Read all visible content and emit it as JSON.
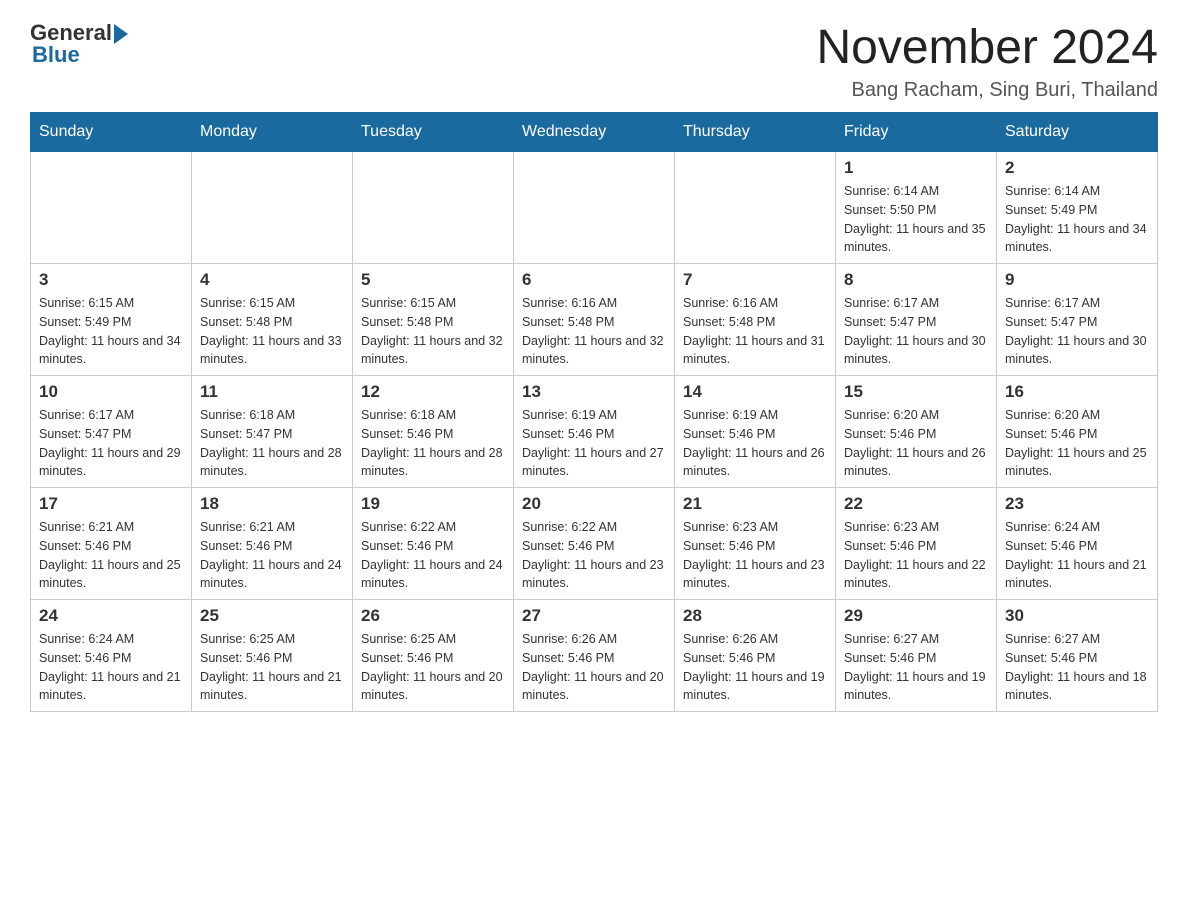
{
  "header": {
    "logo_general": "General",
    "logo_blue": "Blue",
    "month_title": "November 2024",
    "location": "Bang Racham, Sing Buri, Thailand"
  },
  "weekdays": [
    "Sunday",
    "Monday",
    "Tuesday",
    "Wednesday",
    "Thursday",
    "Friday",
    "Saturday"
  ],
  "weeks": [
    [
      {
        "day": "",
        "info": ""
      },
      {
        "day": "",
        "info": ""
      },
      {
        "day": "",
        "info": ""
      },
      {
        "day": "",
        "info": ""
      },
      {
        "day": "",
        "info": ""
      },
      {
        "day": "1",
        "info": "Sunrise: 6:14 AM\nSunset: 5:50 PM\nDaylight: 11 hours and 35 minutes."
      },
      {
        "day": "2",
        "info": "Sunrise: 6:14 AM\nSunset: 5:49 PM\nDaylight: 11 hours and 34 minutes."
      }
    ],
    [
      {
        "day": "3",
        "info": "Sunrise: 6:15 AM\nSunset: 5:49 PM\nDaylight: 11 hours and 34 minutes."
      },
      {
        "day": "4",
        "info": "Sunrise: 6:15 AM\nSunset: 5:48 PM\nDaylight: 11 hours and 33 minutes."
      },
      {
        "day": "5",
        "info": "Sunrise: 6:15 AM\nSunset: 5:48 PM\nDaylight: 11 hours and 32 minutes."
      },
      {
        "day": "6",
        "info": "Sunrise: 6:16 AM\nSunset: 5:48 PM\nDaylight: 11 hours and 32 minutes."
      },
      {
        "day": "7",
        "info": "Sunrise: 6:16 AM\nSunset: 5:48 PM\nDaylight: 11 hours and 31 minutes."
      },
      {
        "day": "8",
        "info": "Sunrise: 6:17 AM\nSunset: 5:47 PM\nDaylight: 11 hours and 30 minutes."
      },
      {
        "day": "9",
        "info": "Sunrise: 6:17 AM\nSunset: 5:47 PM\nDaylight: 11 hours and 30 minutes."
      }
    ],
    [
      {
        "day": "10",
        "info": "Sunrise: 6:17 AM\nSunset: 5:47 PM\nDaylight: 11 hours and 29 minutes."
      },
      {
        "day": "11",
        "info": "Sunrise: 6:18 AM\nSunset: 5:47 PM\nDaylight: 11 hours and 28 minutes."
      },
      {
        "day": "12",
        "info": "Sunrise: 6:18 AM\nSunset: 5:46 PM\nDaylight: 11 hours and 28 minutes."
      },
      {
        "day": "13",
        "info": "Sunrise: 6:19 AM\nSunset: 5:46 PM\nDaylight: 11 hours and 27 minutes."
      },
      {
        "day": "14",
        "info": "Sunrise: 6:19 AM\nSunset: 5:46 PM\nDaylight: 11 hours and 26 minutes."
      },
      {
        "day": "15",
        "info": "Sunrise: 6:20 AM\nSunset: 5:46 PM\nDaylight: 11 hours and 26 minutes."
      },
      {
        "day": "16",
        "info": "Sunrise: 6:20 AM\nSunset: 5:46 PM\nDaylight: 11 hours and 25 minutes."
      }
    ],
    [
      {
        "day": "17",
        "info": "Sunrise: 6:21 AM\nSunset: 5:46 PM\nDaylight: 11 hours and 25 minutes."
      },
      {
        "day": "18",
        "info": "Sunrise: 6:21 AM\nSunset: 5:46 PM\nDaylight: 11 hours and 24 minutes."
      },
      {
        "day": "19",
        "info": "Sunrise: 6:22 AM\nSunset: 5:46 PM\nDaylight: 11 hours and 24 minutes."
      },
      {
        "day": "20",
        "info": "Sunrise: 6:22 AM\nSunset: 5:46 PM\nDaylight: 11 hours and 23 minutes."
      },
      {
        "day": "21",
        "info": "Sunrise: 6:23 AM\nSunset: 5:46 PM\nDaylight: 11 hours and 23 minutes."
      },
      {
        "day": "22",
        "info": "Sunrise: 6:23 AM\nSunset: 5:46 PM\nDaylight: 11 hours and 22 minutes."
      },
      {
        "day": "23",
        "info": "Sunrise: 6:24 AM\nSunset: 5:46 PM\nDaylight: 11 hours and 21 minutes."
      }
    ],
    [
      {
        "day": "24",
        "info": "Sunrise: 6:24 AM\nSunset: 5:46 PM\nDaylight: 11 hours and 21 minutes."
      },
      {
        "day": "25",
        "info": "Sunrise: 6:25 AM\nSunset: 5:46 PM\nDaylight: 11 hours and 21 minutes."
      },
      {
        "day": "26",
        "info": "Sunrise: 6:25 AM\nSunset: 5:46 PM\nDaylight: 11 hours and 20 minutes."
      },
      {
        "day": "27",
        "info": "Sunrise: 6:26 AM\nSunset: 5:46 PM\nDaylight: 11 hours and 20 minutes."
      },
      {
        "day": "28",
        "info": "Sunrise: 6:26 AM\nSunset: 5:46 PM\nDaylight: 11 hours and 19 minutes."
      },
      {
        "day": "29",
        "info": "Sunrise: 6:27 AM\nSunset: 5:46 PM\nDaylight: 11 hours and 19 minutes."
      },
      {
        "day": "30",
        "info": "Sunrise: 6:27 AM\nSunset: 5:46 PM\nDaylight: 11 hours and 18 minutes."
      }
    ]
  ]
}
